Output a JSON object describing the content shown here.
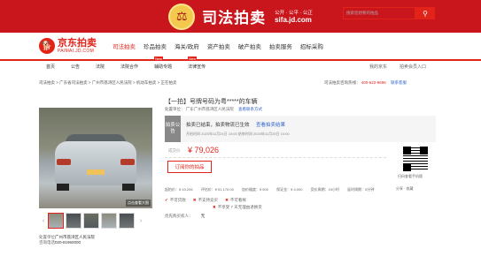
{
  "banner": {
    "title": "司法拍卖",
    "slogan": "公开 · 公平 · 公正",
    "url": "sifa.jd.com"
  },
  "header": {
    "logo_cn": "京东拍卖",
    "logo_en": "PAIMAI.JD.COM",
    "nav": [
      "司法拍卖",
      "珍品拍卖",
      "海关/政府",
      "资产拍卖",
      "破产拍卖",
      "拍卖服务",
      "招标采购"
    ],
    "search_placeholder": "搜索您想要的拍品",
    "search_icon": "search-icon"
  },
  "subnav": {
    "items": [
      "首页",
      "公告",
      "法院",
      "法院合作",
      "辅助专题",
      "法律宣传"
    ],
    "new_items": [
      "辅助专题",
      "法律宣传"
    ],
    "new_label": "New",
    "right_links": [
      "我的京东",
      "拍卖会员入口"
    ]
  },
  "breadcrumb": {
    "text": "司法拍卖 > 广东省司法拍卖 > 广州市荔湾区人民法院 > 机动车拍卖 > 正在拍卖",
    "hotline_label": "司法拍卖咨询热线：",
    "hotline": "400-622-9696",
    "service": "联系客服"
  },
  "image": {
    "caption": "点击查看大图"
  },
  "item": {
    "title": "【一拍】号牌号码为粤*****的车辆",
    "subline_label": "处置单位：",
    "court": "广东广州市荔湾区人民法院",
    "court_link": "查看联系方式"
  },
  "status": {
    "tag": "拍卖公告",
    "main": "拍卖已结束，拍卖物流已生效",
    "link": "查看拍卖结果",
    "sub": "开拍时间 2020年11月24日 10:00 结束时间 2020年11月25日 10:00"
  },
  "price": {
    "label": "成交价",
    "value": "¥ 79,026"
  },
  "buttons": {
    "register": "订阅你的拍品"
  },
  "qr": {
    "text": "扫码查看手机版",
    "share": "分享 · 收藏"
  },
  "params": {
    "items": [
      "起拍价：¥ 43,206",
      "评估价：¥ 51,170.00",
      "加价幅度：¥ 500",
      "保证金：¥ 4,000",
      "竞价周期：24小时",
      "延时周期：5分钟"
    ]
  },
  "flags": {
    "items": [
      "不可贷款",
      "不支持竞买",
      "不可看样"
    ],
    "extra": "不享受 7 天无理由退换货"
  },
  "notice": {
    "label": "优先购买权人：",
    "value": "无"
  },
  "left_info": {
    "label_1": "处置单位：",
    "value_1": "广州市荔湾区人民法院",
    "label_2": "咨询电话：",
    "value_2": "020-81960000"
  }
}
